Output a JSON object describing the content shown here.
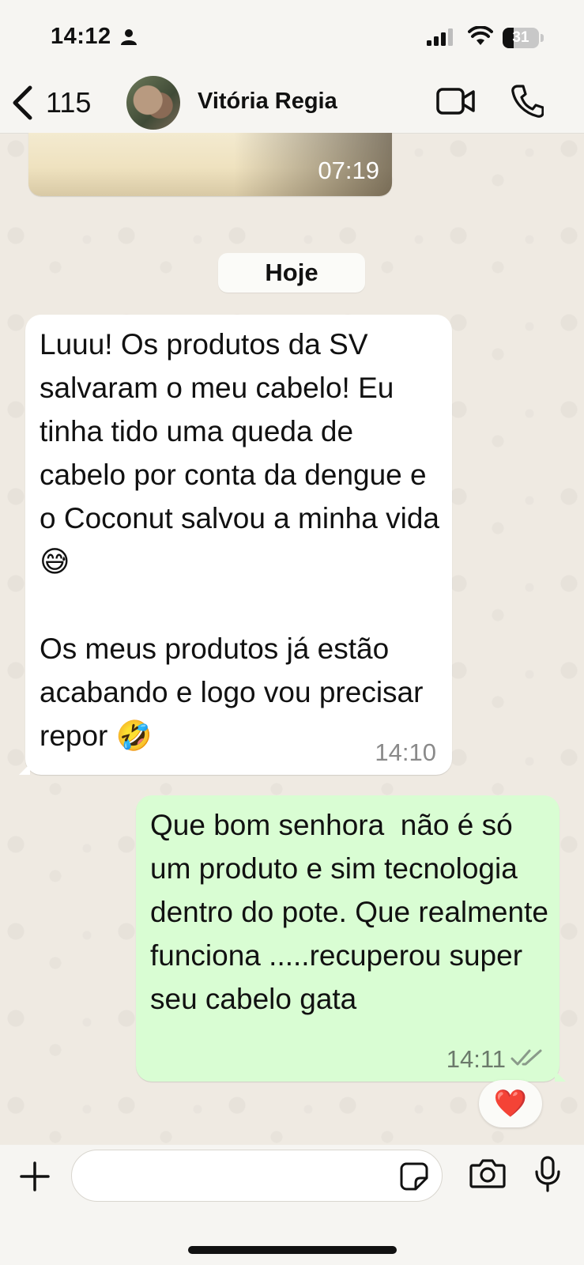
{
  "status_bar": {
    "time": "14:12",
    "battery": "31",
    "battery_level": 0.31
  },
  "header": {
    "back_count": "115",
    "contact_name": "Vitória Regia"
  },
  "media_message": {
    "time": "07:19"
  },
  "date_separator": "Hoje",
  "messages": [
    {
      "direction": "incoming",
      "text": "Luuu! Os produtos da SV salvaram o meu cabelo! Eu tinha tido uma queda de cabelo por conta da dengue e o Coconut salvou a minha vida 😅\n\nOs meus produtos já estão acabando e logo vou precisar repor 🤣",
      "time": "14:10"
    },
    {
      "direction": "outgoing",
      "text": "Que bom senhora  não é só um produto e sim tecnologia dentro do pote. Que realmente funciona .....recuperou super seu cabelo gata",
      "time": "14:11",
      "reaction": "❤️"
    }
  ],
  "input": {
    "placeholder": ""
  },
  "colors": {
    "outgoing_bubble": "#d9fdd3",
    "incoming_bubble": "#ffffff",
    "wallpaper": "#efeae2",
    "read_receipt": "#8a9a8a"
  }
}
